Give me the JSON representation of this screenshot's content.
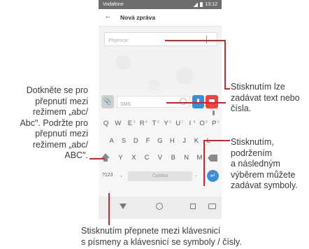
{
  "status_bar": {
    "carrier": "Vodafone",
    "time": "13:12"
  },
  "app_bar": {
    "title": "Nová zpráva"
  },
  "recipient": {
    "placeholder": "Příjemce:"
  },
  "composer": {
    "placeholder": "SMS"
  },
  "keyboard": {
    "row1": [
      {
        "key": "Q",
        "hint": ""
      },
      {
        "key": "W",
        "hint": ""
      },
      {
        "key": "E",
        "hint": "3"
      },
      {
        "key": "R",
        "hint": "4"
      },
      {
        "key": "T",
        "hint": "5"
      },
      {
        "key": "Y",
        "hint": "6"
      },
      {
        "key": "U",
        "hint": "7"
      },
      {
        "key": "I",
        "hint": "8"
      },
      {
        "key": "O",
        "hint": "9"
      },
      {
        "key": "P",
        "hint": "0"
      }
    ],
    "row2": [
      "A",
      "S",
      "D",
      "F",
      "G",
      "H",
      "J",
      "K",
      "L"
    ],
    "row3": [
      "Y",
      "X",
      "C",
      "V",
      "B",
      "N",
      "M"
    ],
    "symbols_key": "?123",
    "comma_key": ",",
    "space_label": "Čeština",
    "period_key": "."
  },
  "annotations": {
    "left": [
      "Dotkněte se pro",
      "přepnutí mezi",
      "režimem „abc/",
      "Abc\". Podržte pro",
      "přepnutí mezi",
      "režimem „abc/",
      "ABC\"."
    ],
    "text_input": [
      "Stisknutím lze",
      "zadávat text nebo",
      "čísla."
    ],
    "symbols": [
      "Stisknutím,",
      "podržením",
      "a následným",
      "výběrem můžete",
      "zadávat symboly."
    ],
    "bottom": [
      "Stisknutím přepnete mezi klávesnicí",
      "s písmeny a klávesnicí se symboly / čísly."
    ]
  },
  "colors": {
    "accent_blue": "#3c8fd6",
    "camera_red": "#e9443e",
    "callout_red": "#d2232a",
    "status_bar": "#6d6d6d"
  },
  "icons": [
    "signal-icon",
    "battery-icon",
    "back-arrow-icon",
    "attach-icon",
    "emoji-icon",
    "microphone-icon",
    "camera-icon",
    "shift-icon",
    "backspace-icon",
    "enter-icon",
    "nav-back-icon",
    "nav-home-icon",
    "nav-recents-icon",
    "nav-keyboard-icon"
  ]
}
